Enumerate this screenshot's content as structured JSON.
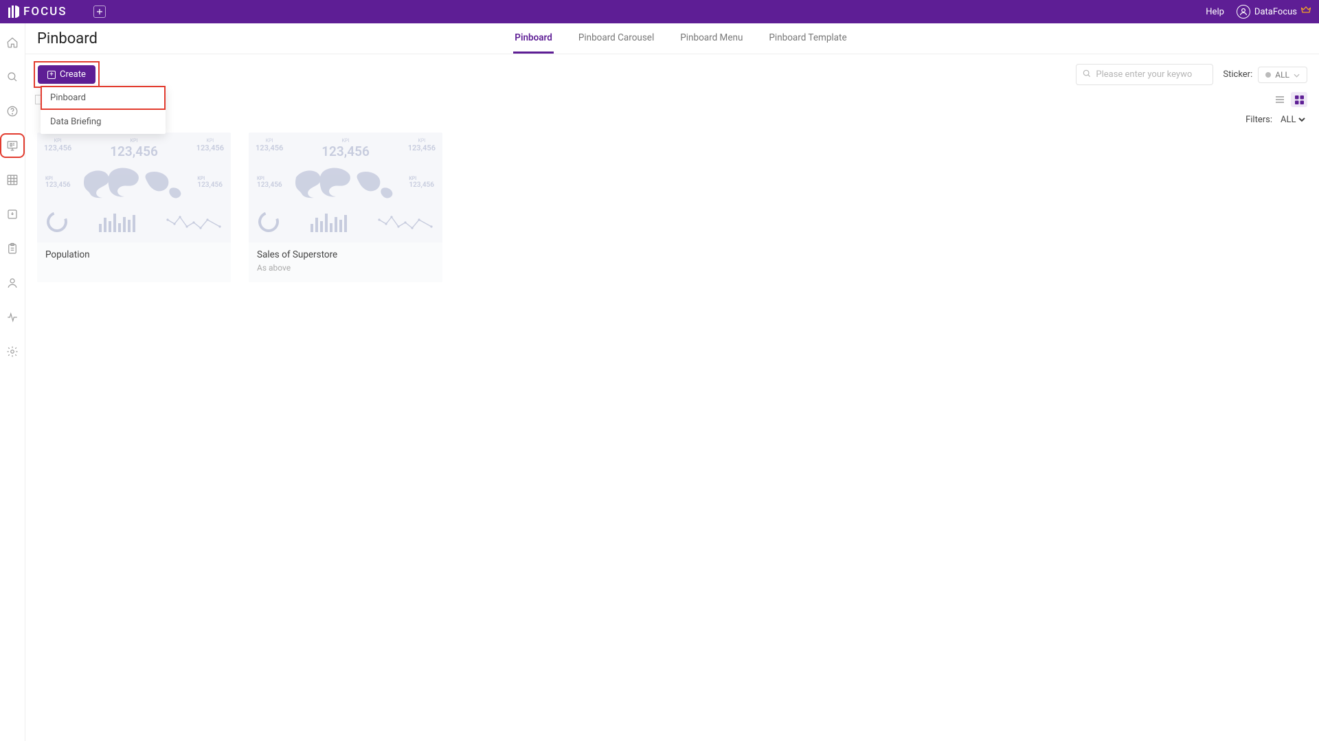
{
  "topbar": {
    "brand": "FOCUS",
    "help": "Help",
    "username": "DataFocus"
  },
  "page": {
    "title": "Pinboard"
  },
  "tabs": {
    "items": [
      {
        "label": "Pinboard",
        "active": true
      },
      {
        "label": "Pinboard Carousel",
        "active": false
      },
      {
        "label": "Pinboard Menu",
        "active": false
      },
      {
        "label": "Pinboard Template",
        "active": false
      }
    ]
  },
  "toolbar": {
    "create_label": "Create",
    "search_placeholder": "Please enter your keywo",
    "sticker_label": "Sticker:",
    "sticker_value": "ALL"
  },
  "create_menu": {
    "items": [
      {
        "label": "Pinboard",
        "highlighted": true
      },
      {
        "label": "Data Briefing",
        "highlighted": false
      }
    ]
  },
  "filters": {
    "label": "Filters:",
    "value": "ALL"
  },
  "preview": {
    "kpi_label": "KPI",
    "kpi_small": "123,456",
    "kpi_big": "123,456"
  },
  "cards": [
    {
      "title": "Population",
      "subtitle": ""
    },
    {
      "title": "Sales of Superstore",
      "subtitle": "As above"
    }
  ]
}
